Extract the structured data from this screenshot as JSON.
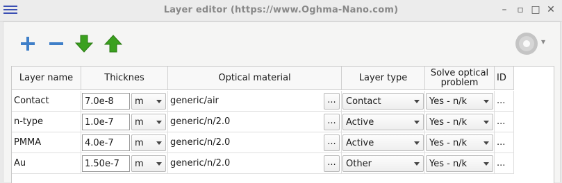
{
  "window": {
    "title": "Layer editor (https://www.Oghma-Nano.com)",
    "controls": {
      "minimize": "–",
      "restore": "▫",
      "maximize": "□",
      "close": "✕"
    }
  },
  "toolbar": {
    "add_icon": "plus-icon",
    "remove_icon": "minus-icon",
    "down_icon": "arrow-down-icon",
    "up_icon": "arrow-up-icon",
    "right_icon": "disc-icon",
    "right_dropdown": "▾"
  },
  "table": {
    "headers": [
      "Layer name",
      "Thicknes",
      "Optical material",
      "Layer type",
      "Solve optical\nproblem",
      "ID"
    ],
    "browse_label": "...",
    "id_label": "...",
    "rows": [
      {
        "name": "Contact",
        "thickness": "7.0e-8",
        "unit": "m",
        "material": "generic/air",
        "type": "Contact",
        "solve": "Yes - n/k"
      },
      {
        "name": "n-type",
        "thickness": "1.0e-7",
        "unit": "m",
        "material": "generic/n/2.0",
        "type": "Active",
        "solve": "Yes - n/k"
      },
      {
        "name": "PMMA",
        "thickness": "4.0e-7",
        "unit": "m",
        "material": "generic/n/2.0",
        "type": "Active",
        "solve": "Yes - n/k"
      },
      {
        "name": "Au",
        "thickness": "1.50e-7",
        "unit": "m",
        "material": "generic/n/2.0",
        "type": "Other",
        "solve": "Yes - n/k"
      }
    ]
  },
  "colors": {
    "accent": "#3a4fb3",
    "plus": "#3f7fc8",
    "minus": "#3f7fc8",
    "arrow_green": "#3aa01e"
  }
}
